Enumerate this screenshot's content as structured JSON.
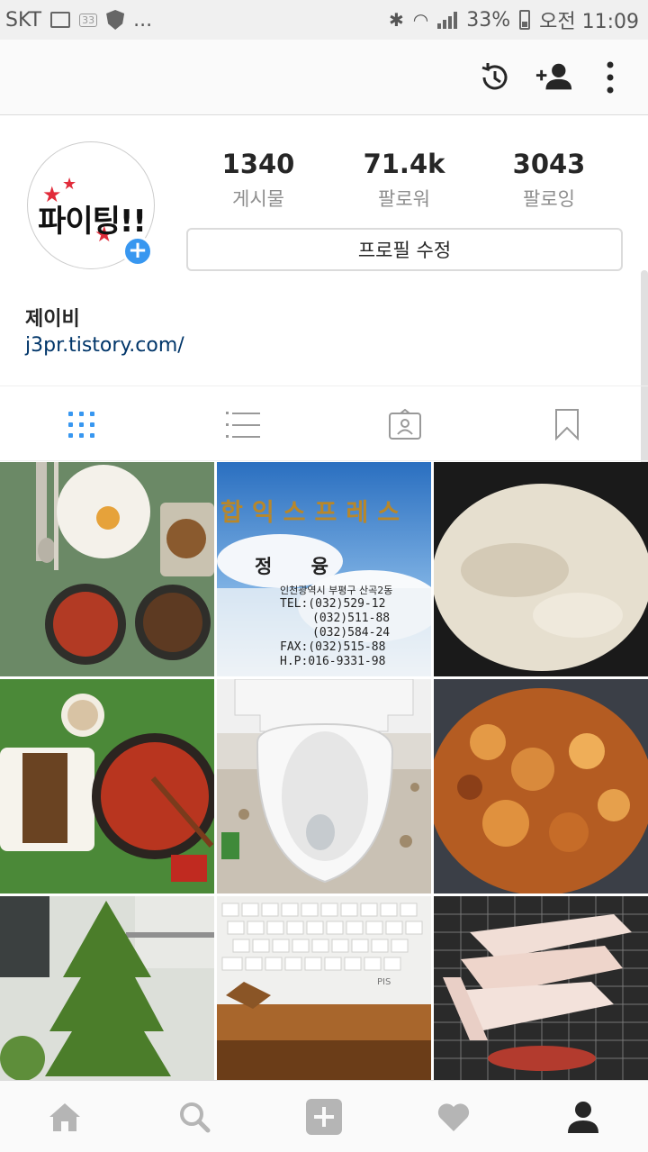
{
  "status_bar": {
    "carrier": "SKT",
    "notification_badge": "33",
    "more": "...",
    "battery": "33%",
    "time": "오전 11:09"
  },
  "profile": {
    "avatar_text": "파이팅!!",
    "posts_count": "1340",
    "posts_label": "게시물",
    "followers_count": "71.4k",
    "followers_label": "팔로워",
    "following_count": "3043",
    "following_label": "팔로잉",
    "edit_profile_label": "프로필 수정",
    "name": "제이비",
    "website": "j3pr.tistory.com/"
  },
  "tabs": [
    "grid-icon",
    "list-icon",
    "tagged-icon",
    "saved-icon"
  ],
  "photos": [
    {
      "name": "photo-korean-meal",
      "colors": [
        "#6f8a6a",
        "#f2efe6",
        "#b73a2a"
      ]
    },
    {
      "name": "photo-business-card",
      "colors": [
        "#2a78c8",
        "#e8eef5",
        "#1a1a1a"
      ]
    },
    {
      "name": "photo-rice-pot",
      "colors": [
        "#1c1c1c",
        "#e9e2d4",
        "#cfc6b3"
      ]
    },
    {
      "name": "photo-tteokbokki",
      "colors": [
        "#4f8a3c",
        "#b8382a",
        "#f6f2e9"
      ]
    },
    {
      "name": "photo-toilet",
      "colors": [
        "#f4f4f4",
        "#d9d9d9",
        "#8a7f70"
      ]
    },
    {
      "name": "photo-stew",
      "colors": [
        "#b25a22",
        "#e08a3a",
        "#6c2e14"
      ]
    },
    {
      "name": "photo-plant",
      "colors": [
        "#4a7a2c",
        "#9dbb6a",
        "#d9dcd6"
      ]
    },
    {
      "name": "photo-keyboard",
      "colors": [
        "#f2f2f0",
        "#c98b4a",
        "#7a4a1c"
      ]
    },
    {
      "name": "photo-grilled-pork",
      "colors": [
        "#2b2b2b",
        "#f0dad2",
        "#b0403a"
      ]
    }
  ],
  "business_card": {
    "title": "합익스프레스",
    "name": "정 융",
    "address": "인천광역시 부평구 산곡2동",
    "lines": [
      "TEL:(032)529-12",
      "(032)511-88",
      "(032)584-24",
      "FAX:(032)515-88",
      "H.P:016-9331-98"
    ]
  },
  "keyboard_brand": "PIS",
  "bottom_nav": [
    "home-icon",
    "search-icon",
    "add-icon",
    "heart-icon",
    "profile-icon"
  ]
}
